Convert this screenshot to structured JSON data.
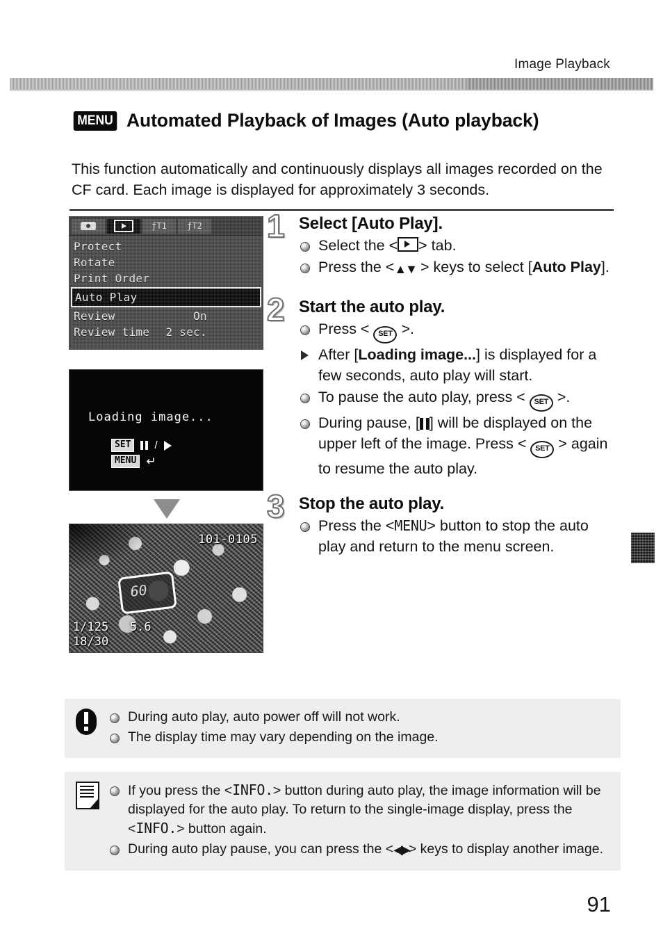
{
  "header": {
    "running_title": "Image Playback"
  },
  "section": {
    "menu_chip": "MENU",
    "title": "Automated Playback of Images (Auto playback)",
    "intro": "This function automatically and continuously displays all images recorded on the CF card. Each image is displayed for approximately 3 seconds."
  },
  "menu_screen": {
    "tabs": [
      {
        "name": "shooting-tab",
        "label": ""
      },
      {
        "name": "playback-tab",
        "label": "",
        "active": true
      },
      {
        "name": "setup1-tab",
        "label": "ƒT1"
      },
      {
        "name": "setup2-tab",
        "label": "ƒT2"
      }
    ],
    "items": [
      {
        "label": "Protect",
        "value": ""
      },
      {
        "label": "Rotate",
        "value": ""
      },
      {
        "label": "Print Order",
        "value": ""
      },
      {
        "label": "Auto Play",
        "value": "",
        "selected": true
      },
      {
        "label": "Review",
        "value": "On"
      },
      {
        "label": "Review time",
        "value": "2 sec."
      }
    ]
  },
  "loading_screen": {
    "message": "Loading image...",
    "set_chip": "SET",
    "menu_chip": "MENU",
    "slash": "/",
    "return_glyph": "↵"
  },
  "photo_screen": {
    "file_number": "101-0105",
    "shutter": "1/125",
    "aperture": "5.6",
    "frame_counter": "18/30",
    "box_label": "60"
  },
  "steps": [
    {
      "number": "1",
      "title": "Select [Auto Play].",
      "bullets": [
        {
          "type": "dot",
          "html": "Select the &lt;<span class=\"k-play\" data-name=\"playback-tab-icon\" data-interactable=\"false\"></span>&gt; tab."
        },
        {
          "type": "dot",
          "html": "Press the &lt;<span class=\"k-updown\" data-name=\"up-down-keys-icon\" data-interactable=\"false\">▲▼</span> &gt; keys to select [<b>Auto Play</b>]."
        }
      ]
    },
    {
      "number": "2",
      "title": "Start the auto play.",
      "bullets": [
        {
          "type": "dot",
          "html": "Press &lt; <span class=\"k-set\" data-name=\"set-button-icon\" data-interactable=\"false\">SET</span> &gt;."
        },
        {
          "type": "arrow",
          "html": "After [<b>Loading image...</b>] is displayed for a few seconds, auto play will start."
        },
        {
          "type": "dot",
          "html": "To pause the auto play, press &lt; <span class=\"k-set\" data-name=\"set-button-icon\" data-interactable=\"false\">SET</span> &gt;."
        },
        {
          "type": "dot",
          "html": "During pause, [<span class=\"k-pausebox\" data-name=\"pause-icon\" data-interactable=\"false\"></span>] will be displayed on the upper left of the image. Press &lt; <span class=\"k-set\" data-name=\"set-button-icon\" data-interactable=\"false\">SET</span> &gt; again to resume the auto play."
        }
      ]
    },
    {
      "number": "3",
      "title": "Stop the auto play.",
      "bullets": [
        {
          "type": "dot",
          "html": "Press the &lt;<span class=\"mono-kw\" data-name=\"menu-button-label\" data-interactable=\"false\">MENU</span>&gt; button to stop the auto play and return to the menu screen."
        }
      ]
    }
  ],
  "notes": {
    "warning": {
      "icon": "exclamation-icon",
      "items": [
        "During auto play, auto power off will not work.",
        "The display time may vary depending on the image."
      ]
    },
    "info": {
      "icon": "note-pencil-icon",
      "items_html": [
        "If you press the &lt;<span class=\"mono-kw\" data-name=\"info-button-label\" data-interactable=\"false\">INFO.</span>&gt; button during auto play, the image information will be displayed for the auto play. To return to the single-image display, press the &lt;<span class=\"mono-kw\" data-name=\"info-button-label\" data-interactable=\"false\">INFO.</span>&gt; button again.",
        "During auto play pause, you can press the &lt;<span class=\"k-leftright\" data-name=\"left-right-keys-icon\" data-interactable=\"false\">◀▶</span>&gt; keys to display another image."
      ]
    }
  },
  "page_number": "91"
}
